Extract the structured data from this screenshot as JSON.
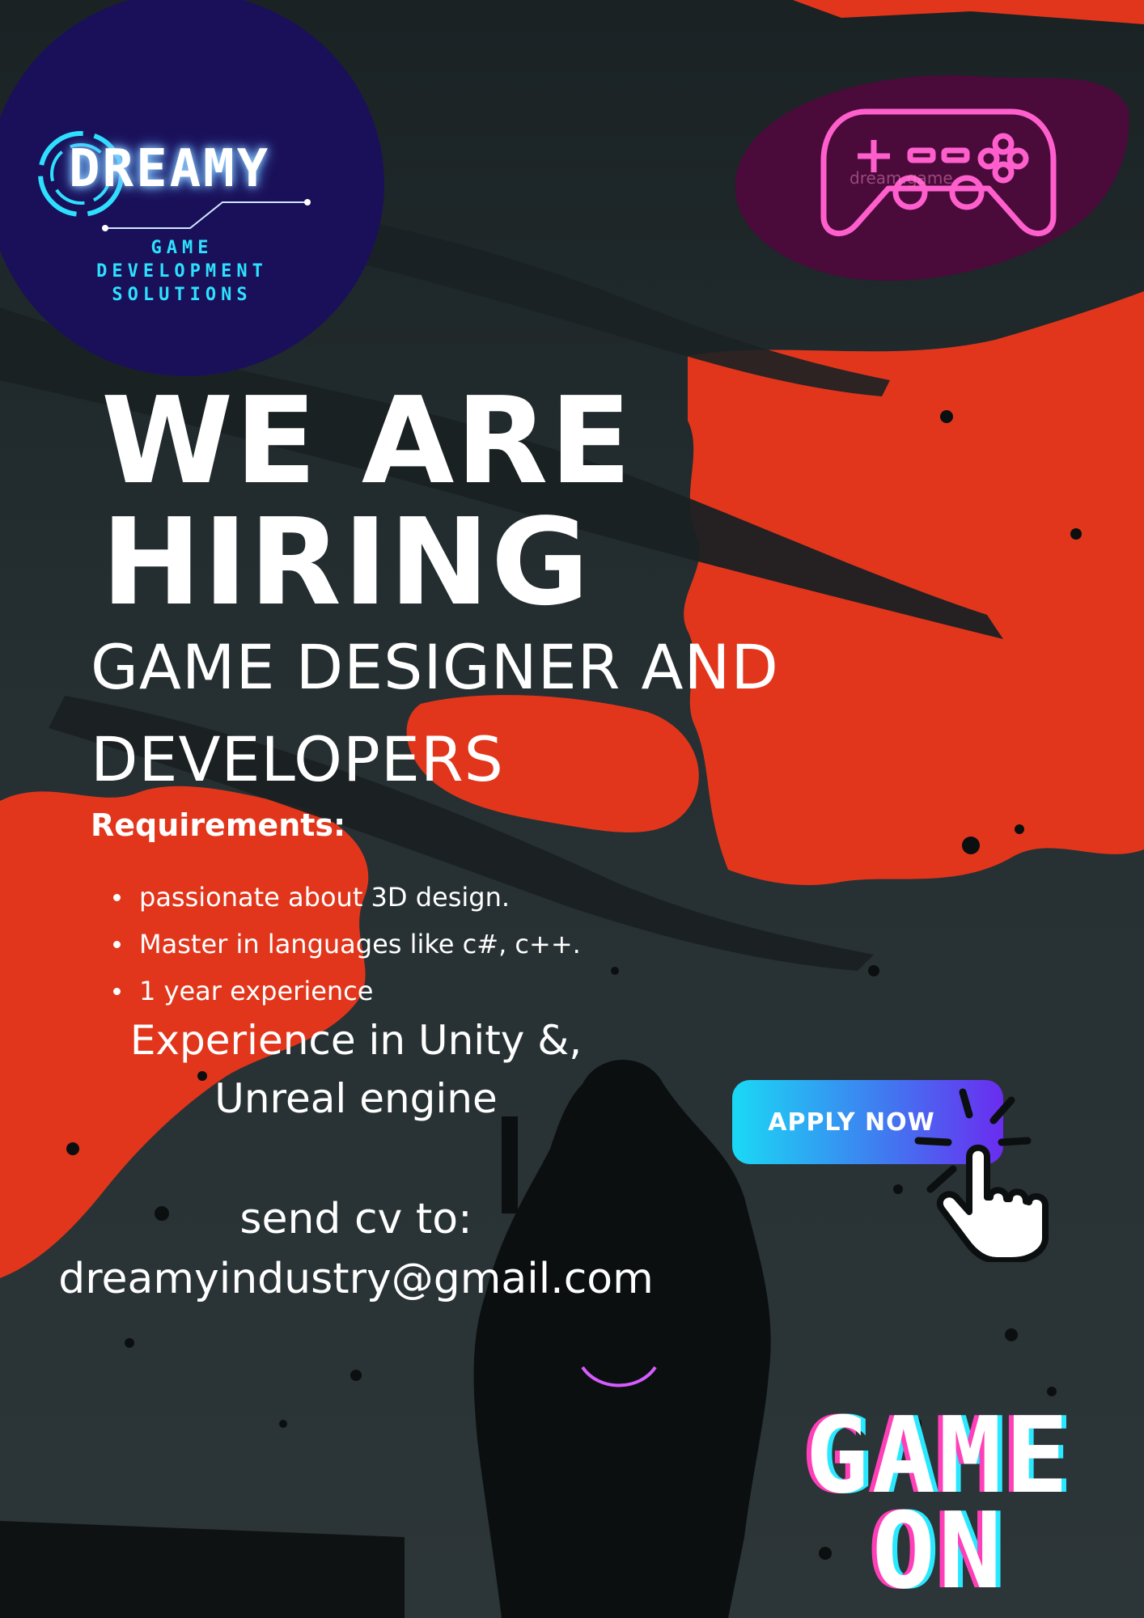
{
  "logo": {
    "name": "DREAMY",
    "tagline_1": "GAME",
    "tagline_2": "DEVELOPMENT",
    "tagline_3": "SOLUTIONS",
    "colors": {
      "circle": "#1a1059",
      "accent": "#2ee0ff"
    }
  },
  "gamepad": {
    "icon": "gamepad-icon",
    "faint_text": "dream.game",
    "color": "#ff4fc2"
  },
  "headline": {
    "line_1": "WE ARE",
    "line_2": "HIRING"
  },
  "role": {
    "line_1": "GAME DESIGNER AND",
    "line_2": "DEVELOPERS"
  },
  "requirements": {
    "title": "Requirements:",
    "items": [
      "passionate about 3D design.",
      "Master in languages like  c#, c++.",
      "1 year experience"
    ]
  },
  "engine": {
    "line_1": "Experience in Unity &,",
    "line_2": "Unreal engine"
  },
  "contact": {
    "label": "send cv to:",
    "email": "dreamyindustry@gmail.com"
  },
  "apply": {
    "label": "APPLY NOW",
    "icon": "pointer-hand-icon"
  },
  "game_on": {
    "line_1": "GAME",
    "line_2": "ON",
    "colors": [
      "#ff3fb8",
      "#29e8ff"
    ]
  },
  "colors": {
    "background": "#1c2628",
    "splash_red": "#e2361c"
  }
}
